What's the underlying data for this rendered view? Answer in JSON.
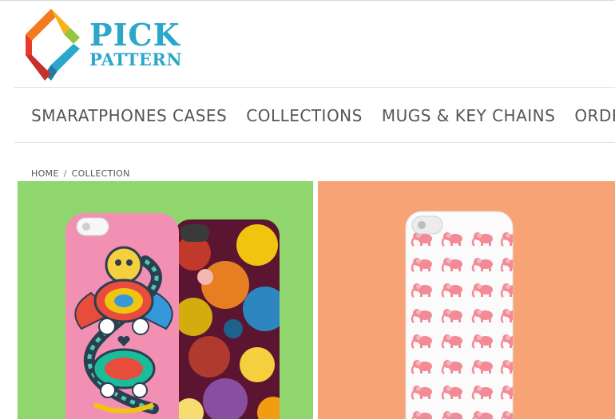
{
  "brand": {
    "line1": "PICK",
    "line2": "PATTERN",
    "color": "#2aa7c9"
  },
  "nav": {
    "items": [
      {
        "label": "SMARATPHONES CASES"
      },
      {
        "label": "COLLECTIONS"
      },
      {
        "label": "MUGS & KEY CHAINS"
      },
      {
        "label": "ORDER STATUS"
      }
    ]
  },
  "breadcrumb": {
    "home": "HOME",
    "separator": "/",
    "current": "COLLECTION"
  },
  "products": [
    {
      "name": "colorful-monster-and-floral-phone-cases",
      "background": "#8fd66f"
    },
    {
      "name": "pink-elephant-pattern-phone-case",
      "background": "#f8a376"
    }
  ]
}
